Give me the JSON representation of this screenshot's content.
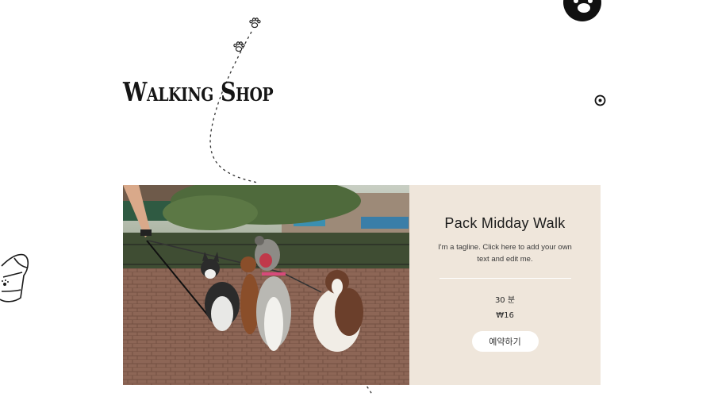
{
  "site": {
    "title": "Walking Shop"
  },
  "service": {
    "name": "Pack Midday Walk",
    "tagline": "I'm a tagline. Click here to add your own text and edit me.",
    "duration": "30 분",
    "price": "₩16",
    "book_label": "예약하기"
  },
  "photo": {
    "description_icon": "dog-walking-photo"
  },
  "icons": {
    "paw": "paw-print-icon",
    "target": "target-icon",
    "bag": "poop-bag-icon"
  },
  "colors": {
    "info_bg": "#efe6db",
    "title": "#151515",
    "button_bg": "#ffffff"
  }
}
